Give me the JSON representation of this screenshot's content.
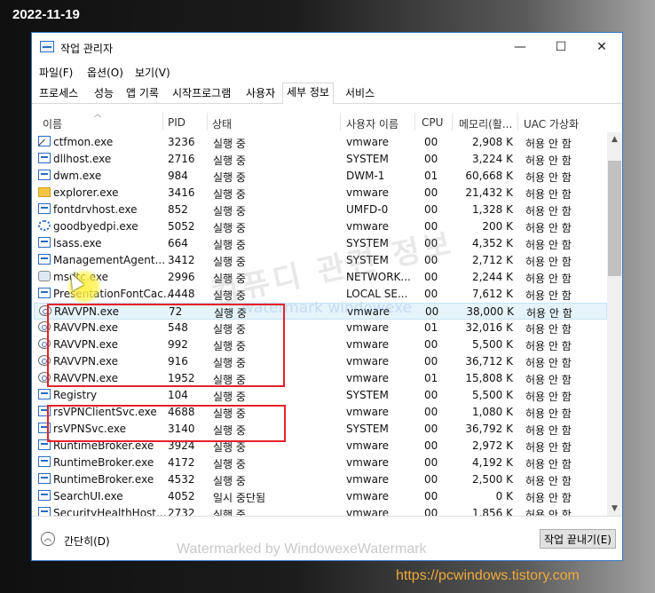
{
  "overlay": {
    "date": "2022-11-19",
    "url": "https://pcwindows.tistory.com",
    "watermark_big": "컴퓨디 관련 정보",
    "watermark_small": "watermark  windowexe",
    "footer_watermark": "Watermarked by WindowexeWatermark"
  },
  "window": {
    "title": "작업 관리자",
    "minimize": "—",
    "maximize": "☐",
    "close": "✕"
  },
  "menu": [
    "파일(F)",
    "옵션(O)",
    "보기(V)"
  ],
  "tabs": [
    "프로세스",
    "성능",
    "앱 기록",
    "시작프로그램",
    "사용자",
    "세부 정보",
    "서비스"
  ],
  "active_tab": "세부 정보",
  "columns": [
    "이름",
    "PID",
    "상태",
    "사용자 이름",
    "CPU",
    "메모리(활...",
    "UAC 가상화"
  ],
  "processes": [
    {
      "icon": "ctfmon-icon",
      "name": "ctfmon.exe",
      "pid": "3236",
      "status": "실행 중",
      "user": "vmware",
      "cpu": "00",
      "mem": "2,908 K",
      "uac": "허용 안 함"
    },
    {
      "icon": "app-icon",
      "name": "dllhost.exe",
      "pid": "2716",
      "status": "실행 중",
      "user": "SYSTEM",
      "cpu": "00",
      "mem": "3,224 K",
      "uac": "허용 안 함"
    },
    {
      "icon": "app-icon",
      "name": "dwm.exe",
      "pid": "984",
      "status": "실행 중",
      "user": "DWM-1",
      "cpu": "01",
      "mem": "60,668 K",
      "uac": "허용 안 함"
    },
    {
      "icon": "folder-icon",
      "name": "explorer.exe",
      "pid": "3416",
      "status": "실행 중",
      "user": "vmware",
      "cpu": "00",
      "mem": "21,432 K",
      "uac": "허용 안 함"
    },
    {
      "icon": "app-icon",
      "name": "fontdrvhost.exe",
      "pid": "852",
      "status": "실행 중",
      "user": "UMFD-0",
      "cpu": "00",
      "mem": "1,328 K",
      "uac": "허용 안 함"
    },
    {
      "icon": "gear-icon",
      "name": "goodbyedpi.exe",
      "pid": "5052",
      "status": "실행 중",
      "user": "vmware",
      "cpu": "00",
      "mem": "200 K",
      "uac": "허용 안 함"
    },
    {
      "icon": "app-icon",
      "name": "lsass.exe",
      "pid": "664",
      "status": "실행 중",
      "user": "SYSTEM",
      "cpu": "00",
      "mem": "4,352 K",
      "uac": "허용 안 함"
    },
    {
      "icon": "app-icon",
      "name": "ManagementAgent...",
      "pid": "3412",
      "status": "실행 중",
      "user": "SYSTEM",
      "cpu": "00",
      "mem": "2,712 K",
      "uac": "허용 안 함"
    },
    {
      "icon": "network-icon",
      "name": "msdtc.exe",
      "pid": "2996",
      "status": "실행 중",
      "user": "NETWORK...",
      "cpu": "00",
      "mem": "2,244 K",
      "uac": "허용 안 함"
    },
    {
      "icon": "app-icon",
      "name": "PresentationFontCac...",
      "pid": "4448",
      "status": "실행 중",
      "user": "LOCAL SE...",
      "cpu": "00",
      "mem": "7,612 K",
      "uac": "허용 안 함"
    },
    {
      "icon": "vpn-icon",
      "name": "RAVVPN.exe",
      "pid": "72",
      "status": "실행 중",
      "user": "vmware",
      "cpu": "00",
      "mem": "38,000 K",
      "uac": "허용 안 함",
      "selected": true
    },
    {
      "icon": "vpn-icon",
      "name": "RAVVPN.exe",
      "pid": "548",
      "status": "실행 중",
      "user": "vmware",
      "cpu": "01",
      "mem": "32,016 K",
      "uac": "허용 안 함"
    },
    {
      "icon": "vpn-icon",
      "name": "RAVVPN.exe",
      "pid": "992",
      "status": "실행 중",
      "user": "vmware",
      "cpu": "00",
      "mem": "5,500 K",
      "uac": "허용 안 함"
    },
    {
      "icon": "vpn-icon",
      "name": "RAVVPN.exe",
      "pid": "916",
      "status": "실행 중",
      "user": "vmware",
      "cpu": "00",
      "mem": "36,712 K",
      "uac": "허용 안 함"
    },
    {
      "icon": "vpn-icon",
      "name": "RAVVPN.exe",
      "pid": "1952",
      "status": "실행 중",
      "user": "vmware",
      "cpu": "01",
      "mem": "15,808 K",
      "uac": "허용 안 함"
    },
    {
      "icon": "app-icon",
      "name": "Registry",
      "pid": "104",
      "status": "실행 중",
      "user": "SYSTEM",
      "cpu": "00",
      "mem": "5,500 K",
      "uac": "허용 안 함"
    },
    {
      "icon": "app-icon",
      "name": "rsVPNClientSvc.exe",
      "pid": "4688",
      "status": "실행 중",
      "user": "vmware",
      "cpu": "00",
      "mem": "1,080 K",
      "uac": "허용 안 함"
    },
    {
      "icon": "app-icon",
      "name": "rsVPNSvc.exe",
      "pid": "3140",
      "status": "실행 중",
      "user": "SYSTEM",
      "cpu": "00",
      "mem": "36,792 K",
      "uac": "허용 안 함"
    },
    {
      "icon": "app-icon",
      "name": "RuntimeBroker.exe",
      "pid": "3924",
      "status": "실행 중",
      "user": "vmware",
      "cpu": "00",
      "mem": "2,972 K",
      "uac": "허용 안 함"
    },
    {
      "icon": "app-icon",
      "name": "RuntimeBroker.exe",
      "pid": "4172",
      "status": "실행 중",
      "user": "vmware",
      "cpu": "00",
      "mem": "4,192 K",
      "uac": "허용 안 함"
    },
    {
      "icon": "app-icon",
      "name": "RuntimeBroker.exe",
      "pid": "4532",
      "status": "실행 중",
      "user": "vmware",
      "cpu": "00",
      "mem": "2,500 K",
      "uac": "허용 안 함"
    },
    {
      "icon": "app-icon",
      "name": "SearchUI.exe",
      "pid": "4052",
      "status": "일시 중단됨",
      "user": "vmware",
      "cpu": "00",
      "mem": "0 K",
      "uac": "허용 안 함"
    },
    {
      "icon": "app-icon",
      "name": "SecurityHealthHost...",
      "pid": "2732",
      "status": "실행 중",
      "user": "vmware",
      "cpu": "00",
      "mem": "1,856 K",
      "uac": "허용 안 함"
    }
  ],
  "footer": {
    "fewer_details": "간단히(D)",
    "end_task": "작업 끝내기(E)"
  }
}
